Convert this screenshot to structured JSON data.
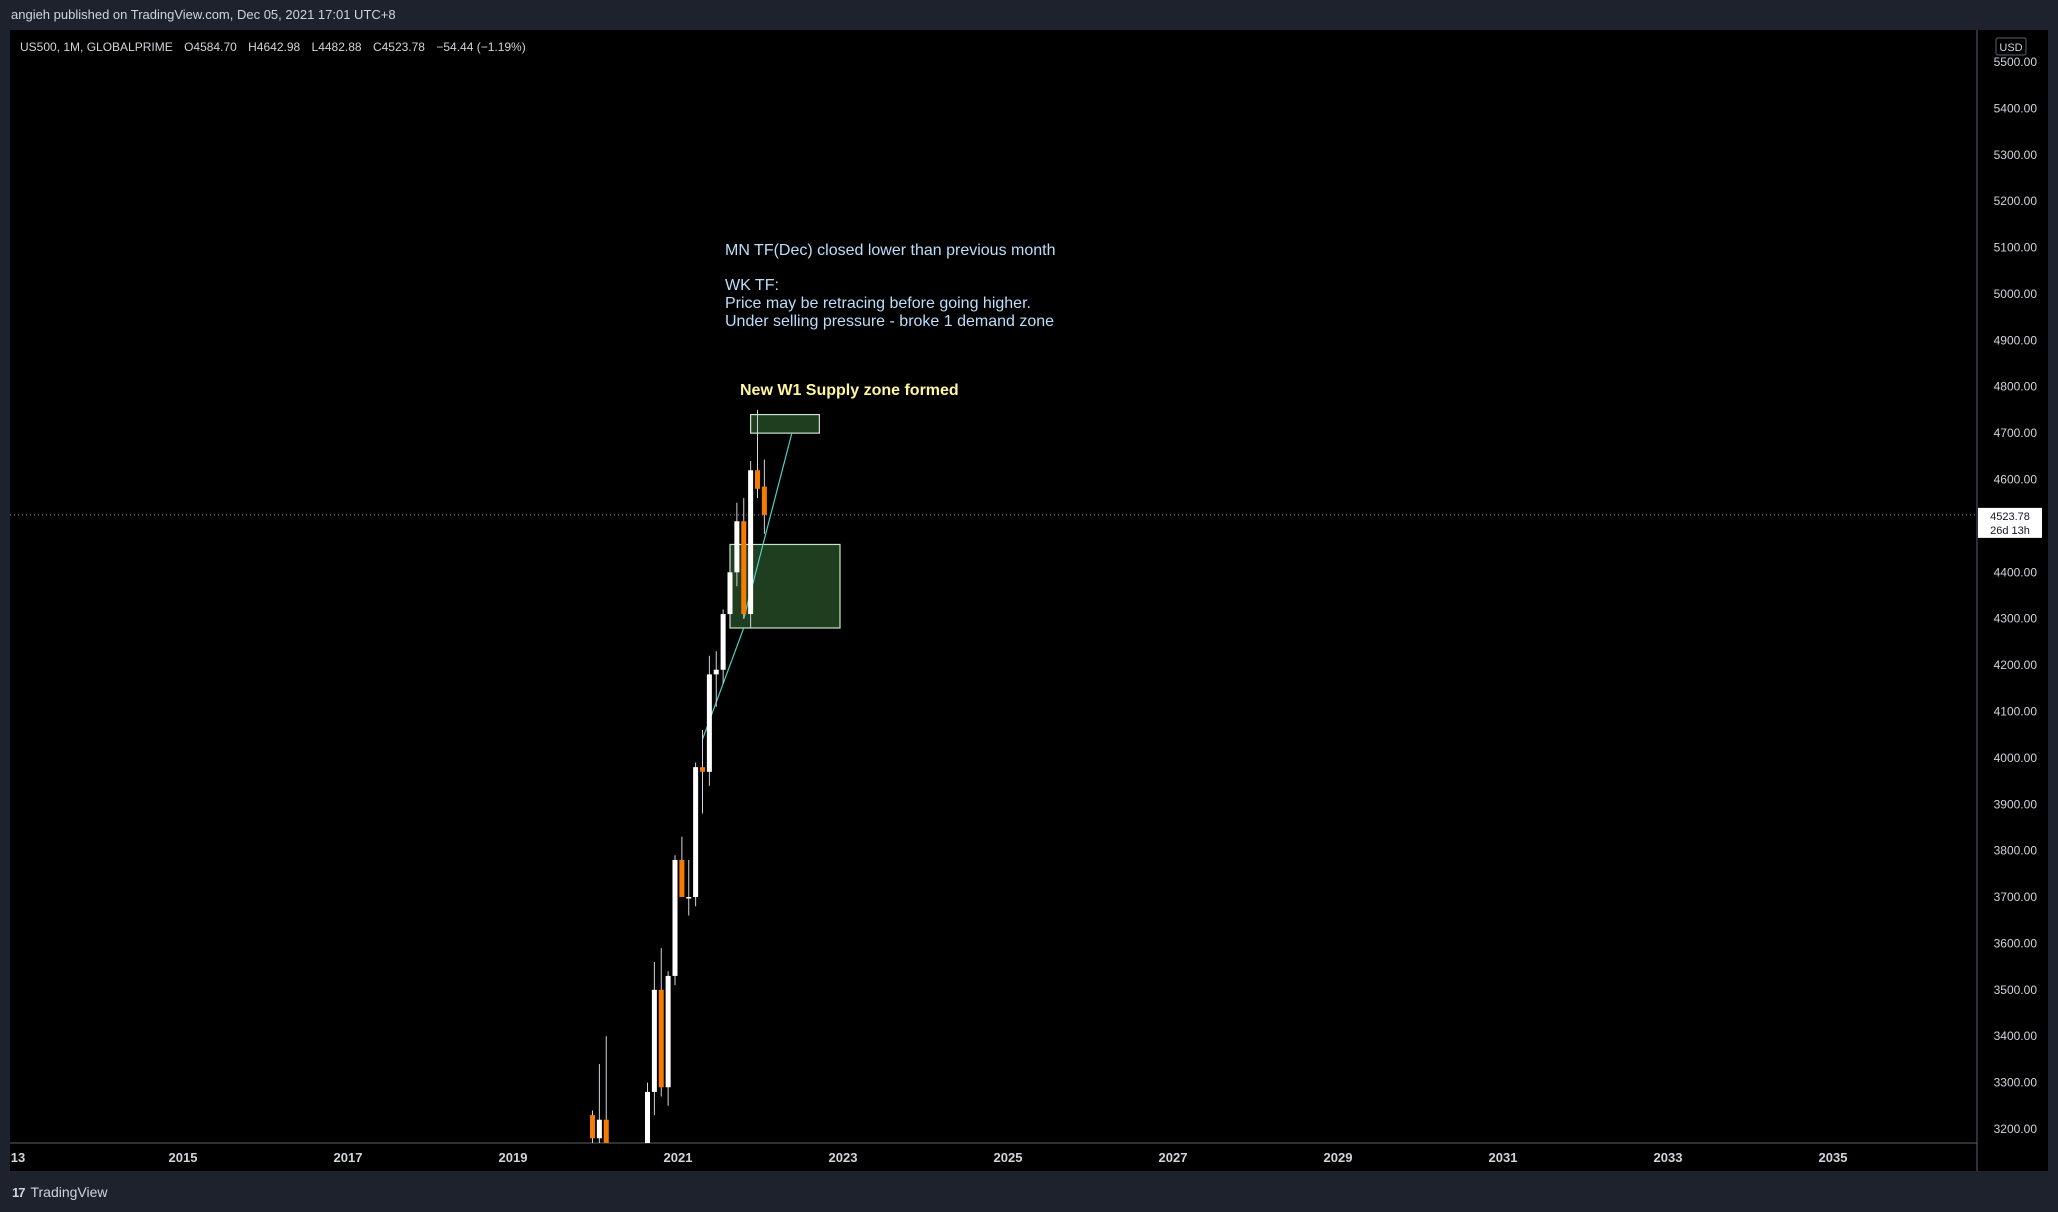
{
  "header": {
    "published": "angieh published on TradingView.com, Dec 05, 2021 17:01 UTC+8"
  },
  "legend": {
    "symbol": "US500, 1M, GLOBALPRIME",
    "open": "O4584.70",
    "high": "H4642.98",
    "low": "L4482.88",
    "close": "C4523.78",
    "change": "−54.44 (−1.19%)"
  },
  "price_scale": {
    "currency": "USD",
    "last_price_label": "4523.78",
    "countdown_label": "26d 13h"
  },
  "annotations": {
    "note_line1": "MN TF(Dec) closed lower than previous month",
    "note_line2": "WK TF:",
    "note_line3": "Price may be retracing before going higher.",
    "note_line4": "Under selling pressure - broke 1 demand zone",
    "supply_label": "New W1 Supply zone formed"
  },
  "footer": {
    "brand": "TradingView",
    "brand_icon": "tradingview-logo-icon"
  },
  "colors": {
    "background": "#000000",
    "frame": "#1e222d",
    "bull_candle": "#ffffff",
    "bear_candle": "#f57c00",
    "wick": "#d1d4dc",
    "zone_fill": "#1f3d1f",
    "zone_border": "#c8e6c9",
    "annotation_text": "#bbdefb",
    "supply_text": "#fff59d",
    "trend_line": "#4dd0c4",
    "axis_text": "#d1d4dc",
    "last_price_bg": "#ffffff"
  },
  "chart_data": {
    "type": "candlestick",
    "timeframe": "1M",
    "ylim": [
      3150,
      5540
    ],
    "x_ticks": [
      "13",
      "2015",
      "2017",
      "2019",
      "2021",
      "2023",
      "2025",
      "2027",
      "2029",
      "2031",
      "2033",
      "2035"
    ],
    "y_ticks": [
      3200,
      3300,
      3400,
      3500,
      3600,
      3700,
      3800,
      3900,
      4000,
      4100,
      4200,
      4300,
      4400,
      4500,
      4600,
      4700,
      4800,
      4900,
      5000,
      5100,
      5200,
      5300,
      5400,
      5500
    ],
    "last_price": 4523.78,
    "candles": [
      {
        "date": "2020-01",
        "open": 3230,
        "high": 3240,
        "low": 3130,
        "close": 3180
      },
      {
        "date": "2020-02",
        "open": 3180,
        "high": 3340,
        "low": 3150,
        "close": 3220
      },
      {
        "date": "2020-03",
        "open": 3220,
        "high": 3400,
        "low": 3120,
        "close": 3170
      },
      {
        "date": "2020-09",
        "open": 3150,
        "high": 3300,
        "low": 3140,
        "close": 3280
      },
      {
        "date": "2020-10",
        "open": 3280,
        "high": 3560,
        "low": 3230,
        "close": 3500
      },
      {
        "date": "2020-11",
        "open": 3500,
        "high": 3590,
        "low": 3270,
        "close": 3290
      },
      {
        "date": "2020-12",
        "open": 3290,
        "high": 3540,
        "low": 3250,
        "close": 3530
      },
      {
        "date": "2021-01",
        "open": 3530,
        "high": 3790,
        "low": 3510,
        "close": 3780
      },
      {
        "date": "2021-02",
        "open": 3780,
        "high": 3830,
        "low": 3700,
        "close": 3700
      },
      {
        "date": "2021-03",
        "open": 3700,
        "high": 3780,
        "low": 3660,
        "close": 3700
      },
      {
        "date": "2021-04",
        "open": 3700,
        "high": 3990,
        "low": 3680,
        "close": 3980
      },
      {
        "date": "2021-05",
        "open": 3980,
        "high": 4060,
        "low": 3880,
        "close": 3970
      },
      {
        "date": "2021-06",
        "open": 3970,
        "high": 4220,
        "low": 3940,
        "close": 4180
      },
      {
        "date": "2021-07",
        "open": 4180,
        "high": 4230,
        "low": 4110,
        "close": 4190
      },
      {
        "date": "2021-08",
        "open": 4190,
        "high": 4320,
        "low": 4160,
        "close": 4310
      },
      {
        "date": "2021-09",
        "open": 4310,
        "high": 4430,
        "low": 4290,
        "close": 4400
      },
      {
        "date": "2021-10",
        "open": 4400,
        "high": 4550,
        "low": 4370,
        "close": 4510
      },
      {
        "date": "2021-11",
        "open": 4510,
        "high": 4560,
        "low": 4300,
        "close": 4310
      },
      {
        "date": "2021-12",
        "open": 4310,
        "high": 4640,
        "low": 4280,
        "close": 4620
      },
      {
        "date": "2022-01",
        "open": 4620,
        "high": 4750,
        "low": 4560,
        "close": 4580
      },
      {
        "date": "2022-02",
        "open": 4584.7,
        "high": 4642.98,
        "low": 4482.88,
        "close": 4523.78
      }
    ],
    "zones": [
      {
        "name": "supply",
        "x_start": "2021-12",
        "x_end": "2022-10",
        "y_low": 4700,
        "y_high": 4740
      },
      {
        "name": "demand",
        "x_start": "2021-09",
        "x_end": "2023-01",
        "y_low": 4280,
        "y_high": 4460
      }
    ],
    "trend_lines": [
      {
        "from": {
          "date": "2021-05",
          "y": 4040
        },
        "to": {
          "date": "2021-11",
          "y": 4280
        }
      },
      {
        "from": {
          "date": "2021-11",
          "y": 4300
        },
        "to": {
          "date": "2022-06",
          "y": 4700
        }
      }
    ]
  }
}
